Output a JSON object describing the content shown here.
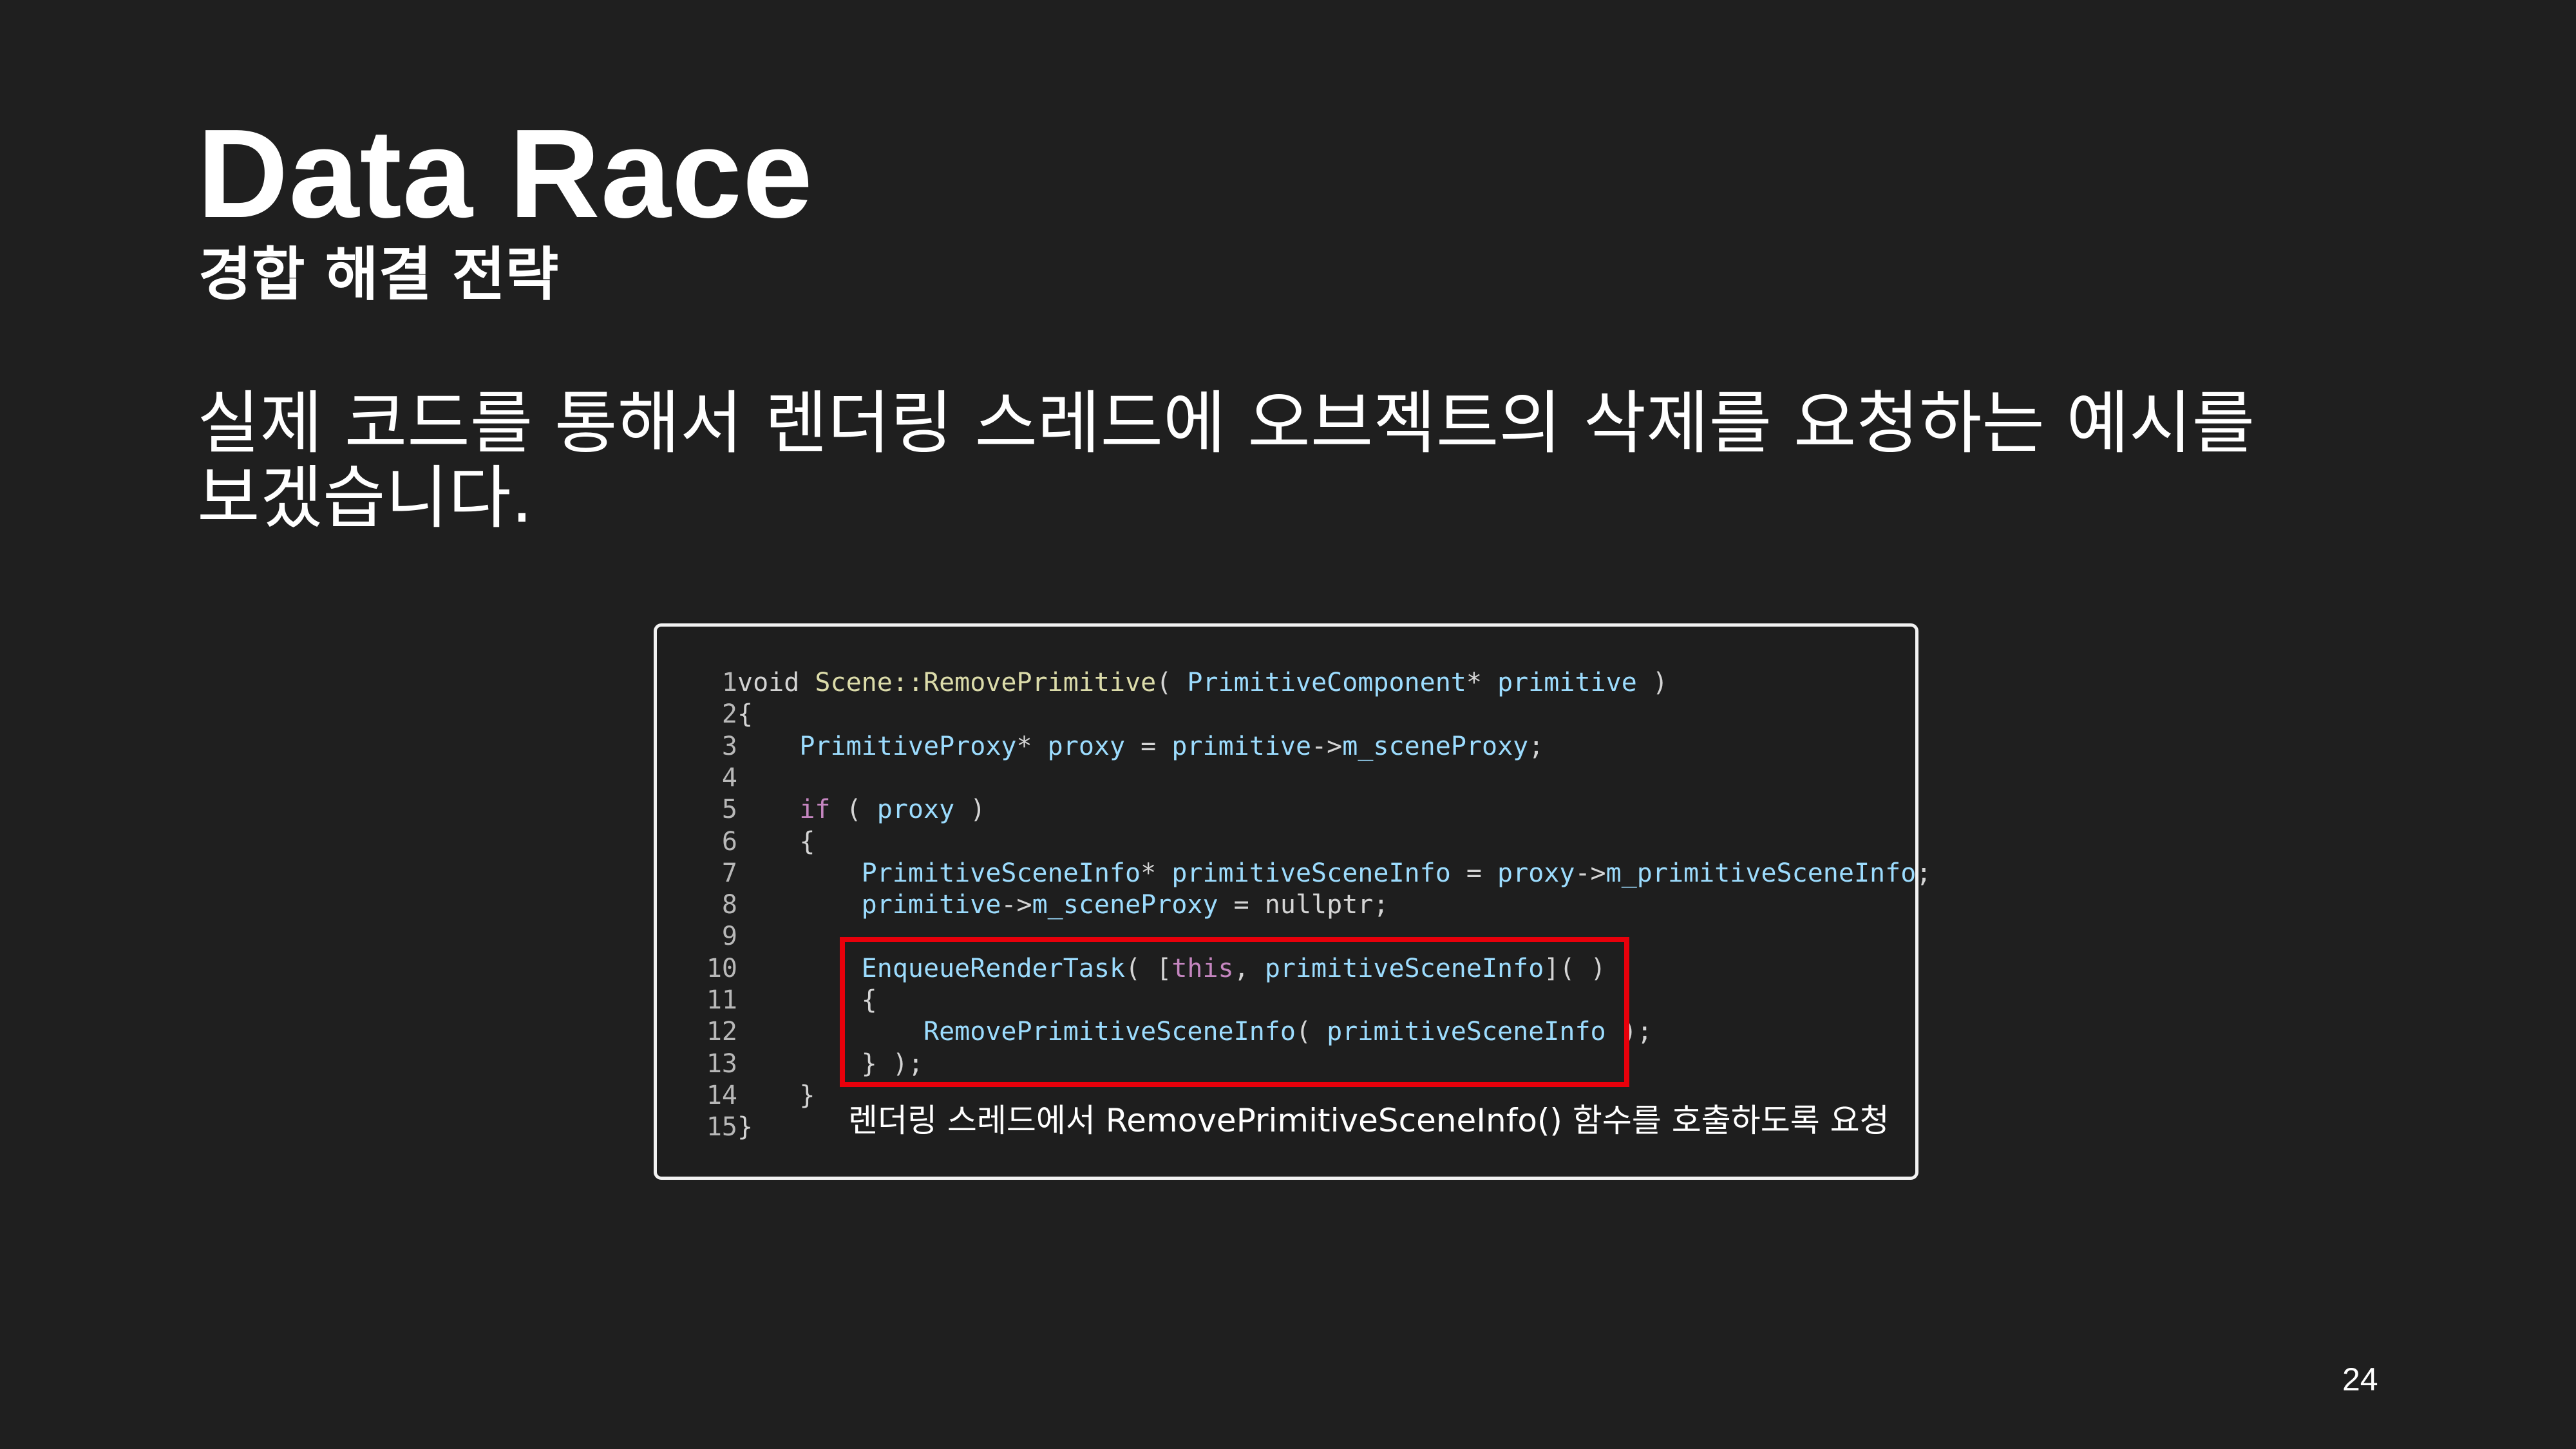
{
  "slide": {
    "title": "Data Race",
    "subtitle": "경합 해결 전략",
    "body": "실제 코드를 통해서 렌더링 스레드에 오브젝트의 삭제를 요청하는 예시를 보겠습니다.",
    "annotation": "렌더링 스레드에서 RemovePrimitiveSceneInfo() 함수를 호출하도록 요청",
    "page_number": "24",
    "highlight_color": "#e8000b"
  },
  "code": {
    "lines": [
      {
        "num": "1",
        "tokens": [
          {
            "text": "void ",
            "type": "pl"
          },
          {
            "text": "Scene::RemovePrimitive",
            "type": "fn"
          },
          {
            "text": "( ",
            "type": "pl"
          },
          {
            "text": "PrimitiveComponent",
            "type": "id"
          },
          {
            "text": "* ",
            "type": "pl"
          },
          {
            "text": "primitive",
            "type": "id"
          },
          {
            "text": " )",
            "type": "pl"
          }
        ]
      },
      {
        "num": "2",
        "tokens": [
          {
            "text": "{",
            "type": "pl"
          }
        ]
      },
      {
        "num": "3",
        "tokens": [
          {
            "text": "    ",
            "type": "pl"
          },
          {
            "text": "PrimitiveProxy",
            "type": "id"
          },
          {
            "text": "* ",
            "type": "pl"
          },
          {
            "text": "proxy",
            "type": "id"
          },
          {
            "text": " = ",
            "type": "pl"
          },
          {
            "text": "primitive",
            "type": "id"
          },
          {
            "text": "->",
            "type": "pl"
          },
          {
            "text": "m_sceneProxy",
            "type": "id"
          },
          {
            "text": ";",
            "type": "pl"
          }
        ]
      },
      {
        "num": "4",
        "tokens": []
      },
      {
        "num": "5",
        "tokens": [
          {
            "text": "    ",
            "type": "pl"
          },
          {
            "text": "if",
            "type": "kw"
          },
          {
            "text": " ( ",
            "type": "pl"
          },
          {
            "text": "proxy",
            "type": "id"
          },
          {
            "text": " )",
            "type": "pl"
          }
        ]
      },
      {
        "num": "6",
        "tokens": [
          {
            "text": "    {",
            "type": "pl"
          }
        ]
      },
      {
        "num": "7",
        "tokens": [
          {
            "text": "        ",
            "type": "pl"
          },
          {
            "text": "PrimitiveSceneInfo",
            "type": "id"
          },
          {
            "text": "* ",
            "type": "pl"
          },
          {
            "text": "primitiveSceneInfo",
            "type": "id"
          },
          {
            "text": " = ",
            "type": "pl"
          },
          {
            "text": "proxy",
            "type": "id"
          },
          {
            "text": "->",
            "type": "pl"
          },
          {
            "text": "m_primitiveSceneInfo",
            "type": "id"
          },
          {
            "text": ";",
            "type": "pl"
          }
        ]
      },
      {
        "num": "8",
        "tokens": [
          {
            "text": "        ",
            "type": "pl"
          },
          {
            "text": "primitive",
            "type": "id"
          },
          {
            "text": "->",
            "type": "pl"
          },
          {
            "text": "m_sceneProxy",
            "type": "id"
          },
          {
            "text": " = nullptr;",
            "type": "pl"
          }
        ]
      },
      {
        "num": "9",
        "tokens": []
      },
      {
        "num": "10",
        "tokens": [
          {
            "text": "        ",
            "type": "pl"
          },
          {
            "text": "EnqueueRenderTask",
            "type": "id"
          },
          {
            "text": "( [",
            "type": "pl"
          },
          {
            "text": "this",
            "type": "kw"
          },
          {
            "text": ", ",
            "type": "pl"
          },
          {
            "text": "primitiveSceneInfo",
            "type": "id"
          },
          {
            "text": "]( )",
            "type": "pl"
          }
        ]
      },
      {
        "num": "11",
        "tokens": [
          {
            "text": "        {",
            "type": "pl"
          }
        ]
      },
      {
        "num": "12",
        "tokens": [
          {
            "text": "            ",
            "type": "pl"
          },
          {
            "text": "RemovePrimitiveSceneInfo",
            "type": "id"
          },
          {
            "text": "( ",
            "type": "pl"
          },
          {
            "text": "primitiveSceneInfo",
            "type": "id"
          },
          {
            "text": " );",
            "type": "pl"
          }
        ]
      },
      {
        "num": "13",
        "tokens": [
          {
            "text": "        } );",
            "type": "pl"
          }
        ]
      },
      {
        "num": "14",
        "tokens": [
          {
            "text": "    }",
            "type": "pl"
          }
        ]
      },
      {
        "num": "15",
        "tokens": [
          {
            "text": "}",
            "type": "pl"
          }
        ]
      }
    ]
  }
}
